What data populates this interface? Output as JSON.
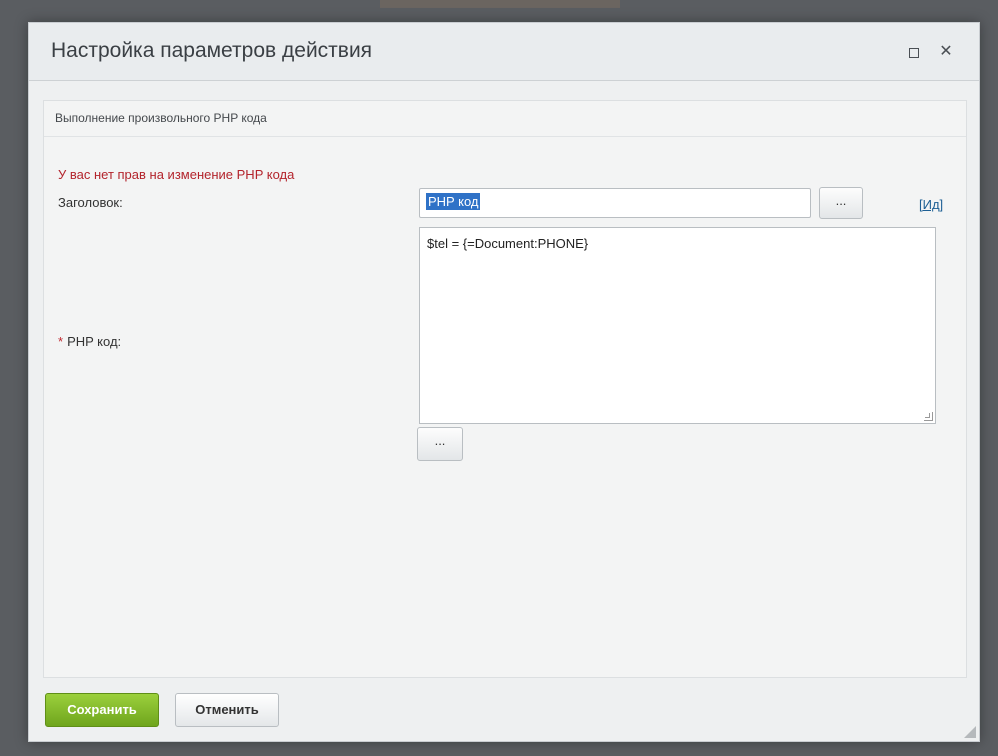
{
  "dialog": {
    "title": "Настройка параметров действия",
    "maximize_icon": "maximize-icon",
    "close_icon": "close-icon",
    "close_glyph": "✕"
  },
  "section": {
    "title": "Выполнение произвольного PHP кода"
  },
  "error": {
    "text": "У вас нет прав на изменение PHP кода",
    "color": "#b3242c"
  },
  "fields": {
    "title_label": "Заголовок:",
    "title_value": "PHP код",
    "title_dots_label": "...",
    "id_link": "[Ид]",
    "php_required_mark": "*",
    "php_label": "PHP код:",
    "php_value": "$tel = {=Document:PHONE}",
    "php_dots_label": "..."
  },
  "footer": {
    "save_label": "Сохранить",
    "cancel_label": "Отменить",
    "save_color": "#7cb327"
  }
}
